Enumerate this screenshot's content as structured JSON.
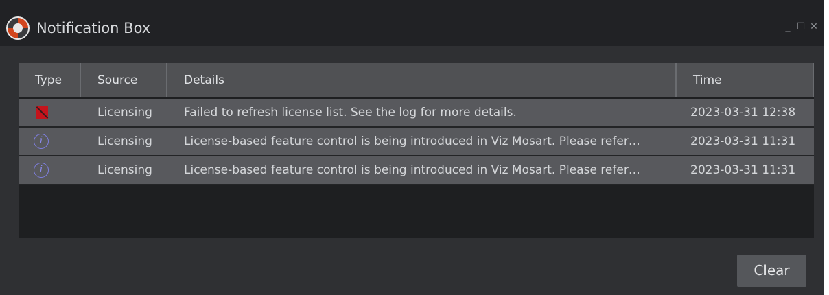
{
  "window": {
    "title": "Notification Box",
    "controls": {
      "minimize": "_",
      "maximize": "☐",
      "close": "✕"
    }
  },
  "table": {
    "columns": {
      "type": "Type",
      "source": "Source",
      "details": "Details",
      "time": "Time"
    },
    "rows": [
      {
        "type_icon": "error-icon",
        "source": "Licensing",
        "details": "Failed to refresh license list. See the log for more details.",
        "time": "2023-03-31 12:38"
      },
      {
        "type_icon": "info-icon",
        "type_glyph": "i",
        "source": "Licensing",
        "details": "License-based feature control is being introduced in Viz Mosart. Please refer…",
        "time": "2023-03-31 11:31"
      },
      {
        "type_icon": "info-icon",
        "type_glyph": "i",
        "source": "Licensing",
        "details": "License-based feature control is being introduced in Viz Mosart. Please refer…",
        "time": "2023-03-31 11:31"
      }
    ]
  },
  "footer": {
    "clear_label": "Clear"
  },
  "colors": {
    "titlebar": "#212225",
    "window_bg": "#2f3033",
    "row_bg": "#58595d",
    "header_bg": "#505154",
    "error": "#c4141c",
    "info": "#8b8bea"
  }
}
